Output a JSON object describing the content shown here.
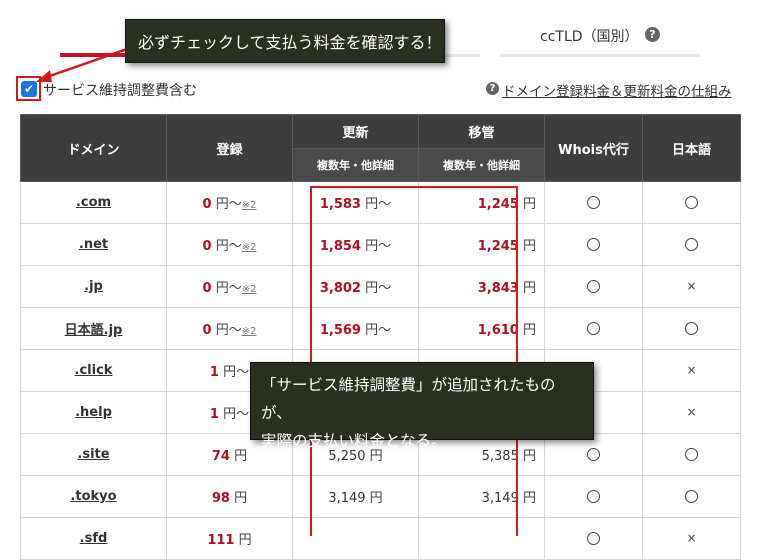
{
  "tabs": {
    "cctld_label": "ccTLD（国別）",
    "help_glyph": "?"
  },
  "filter": {
    "checkbox_label": "サービス維持調整費含む",
    "checked": true,
    "check_glyph": "✔"
  },
  "help_link": {
    "glyph": "?",
    "text": "ドメイン登録料金＆更新料金の仕組み"
  },
  "table": {
    "headers": {
      "domain": "ドメイン",
      "register": "登録",
      "renew": "更新",
      "renew_sub": "複数年・他詳細",
      "transfer": "移管",
      "transfer_sub": "複数年・他詳細",
      "whois": "Whois代行",
      "japanese": "日本語"
    },
    "rows": [
      {
        "domain": ".com",
        "register": "0",
        "register_unit": "円〜",
        "register_note": "※2",
        "renew": "1,583",
        "renew_unit": "円〜",
        "transfer": "1,245",
        "transfer_unit": "円",
        "whois": "circle",
        "japanese": "circle"
      },
      {
        "domain": ".net",
        "register": "0",
        "register_unit": "円〜",
        "register_note": "※2",
        "renew": "1,854",
        "renew_unit": "円〜",
        "transfer": "1,245",
        "transfer_unit": "円",
        "whois": "circle",
        "japanese": "circle"
      },
      {
        "domain": ".jp",
        "register": "0",
        "register_unit": "円〜",
        "register_note": "※2",
        "renew": "3,802",
        "renew_unit": "円〜",
        "transfer": "3,843",
        "transfer_unit": "円",
        "whois": "circle",
        "japanese": "cross"
      },
      {
        "domain": "日本語.jp",
        "register": "0",
        "register_unit": "円〜",
        "register_note": "※2",
        "renew": "1,569",
        "renew_unit": "円〜",
        "transfer": "1,610",
        "transfer_unit": "円",
        "whois": "circle",
        "japanese": "circle"
      },
      {
        "domain": ".click",
        "register": "1",
        "register_unit": "円〜",
        "register_note": "",
        "renew": "",
        "renew_unit": "",
        "transfer": "",
        "transfer_unit": "",
        "whois": "",
        "japanese": "cross"
      },
      {
        "domain": ".help",
        "register": "1",
        "register_unit": "円〜",
        "register_note": "",
        "renew": "",
        "renew_unit": "",
        "transfer": "",
        "transfer_unit": "",
        "whois": "",
        "japanese": "cross"
      },
      {
        "domain": ".site",
        "register": "74",
        "register_unit": "円",
        "register_note": "",
        "renew": "5,250",
        "renew_unit": "円",
        "transfer": "5,385",
        "transfer_unit": "円",
        "whois": "circle",
        "japanese": "circle"
      },
      {
        "domain": ".tokyo",
        "register": "98",
        "register_unit": "円",
        "register_note": "",
        "renew": "3,149",
        "renew_unit": "円",
        "transfer": "3,149",
        "transfer_unit": "円",
        "whois": "circle",
        "japanese": "circle"
      },
      {
        "domain": ".sfd",
        "register": "111",
        "register_unit": "円",
        "register_note": "",
        "renew": "",
        "renew_unit": "",
        "transfer": "",
        "transfer_unit": "",
        "whois": "circle",
        "japanese": "cross"
      }
    ]
  },
  "annotations": {
    "top": "必ずチェックして支払う料金を確認する！",
    "middle_line1": "「サービス維持調整費」が追加されたものが、",
    "middle_line2": "実際の支払い料金となる。"
  },
  "colors": {
    "accent_red": "#c8102e",
    "price_red": "#b01020",
    "header_bg": "#3d3d3d",
    "annotation_bg": "#2a301f",
    "checkbox_blue": "#1a73e8"
  }
}
